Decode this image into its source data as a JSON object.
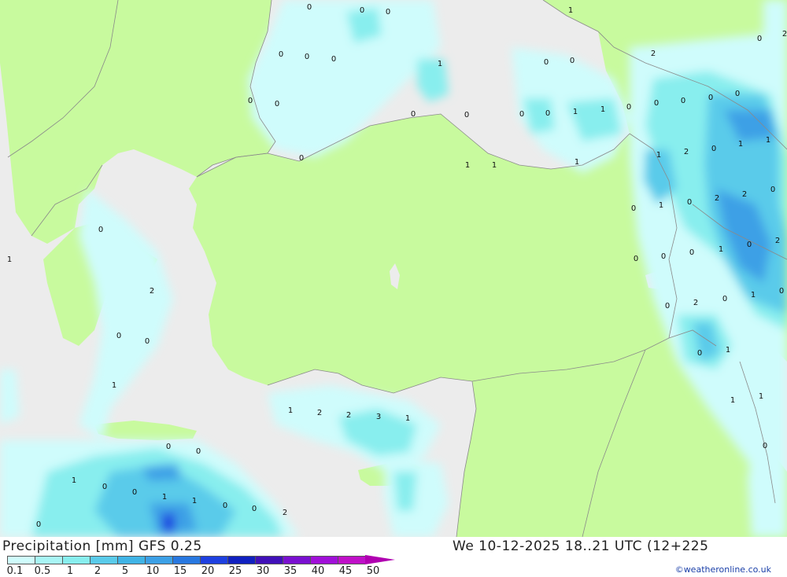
{
  "title": "Precipitation [mm]  GFS 0.25",
  "datetime": "We 10-12-2025 18..21 UTC (12+225",
  "credit": "©weatheronline.co.uk",
  "colors": {
    "land": "#c8fa9e",
    "sea": "#ececec",
    "border": "#8a8a8a",
    "precip_light": "#cffcfc",
    "precip_mid": "#88eeee",
    "precip_heavy": "#5acbea",
    "precip_strong": "#3ca0e6",
    "precip_max": "#1e40e0"
  },
  "legend": {
    "ticks": [
      "0.1",
      "0.5",
      "1",
      "2",
      "5",
      "10",
      "15",
      "20",
      "25",
      "30",
      "35",
      "40",
      "45",
      "50"
    ],
    "colors": [
      "#cffcfc",
      "#a8f5f5",
      "#88eeee",
      "#5acbea",
      "#40b4e6",
      "#3ca0e6",
      "#2878e0",
      "#1e40e0",
      "#1020c0",
      "#4010b8",
      "#7a10d0",
      "#a010d8",
      "#c010c8",
      "#b000b0"
    ]
  },
  "labels": [
    "0",
    "0",
    "0",
    "0",
    "0",
    "0",
    "0",
    "0",
    "1",
    "0",
    "0",
    "0",
    "1",
    "1",
    "0",
    "0",
    "0",
    "0",
    "1",
    "1",
    "0",
    "1",
    "1",
    "0",
    "2",
    "2",
    "0",
    "0",
    "0",
    "0",
    "1",
    "2",
    "0",
    "1",
    "1",
    "0",
    "1",
    "0",
    "2",
    "2",
    "0",
    "0",
    "0",
    "0",
    "1",
    "0",
    "2",
    "0",
    "2",
    "0",
    "1",
    "0",
    "1",
    "0",
    "1",
    "1",
    "0",
    "0",
    "1",
    "2",
    "0",
    "0",
    "1",
    "1",
    "2",
    "2",
    "3",
    "1",
    "0",
    "0",
    "1",
    "0",
    "0",
    "1",
    "1",
    "0",
    "0",
    "2",
    "0"
  ]
}
